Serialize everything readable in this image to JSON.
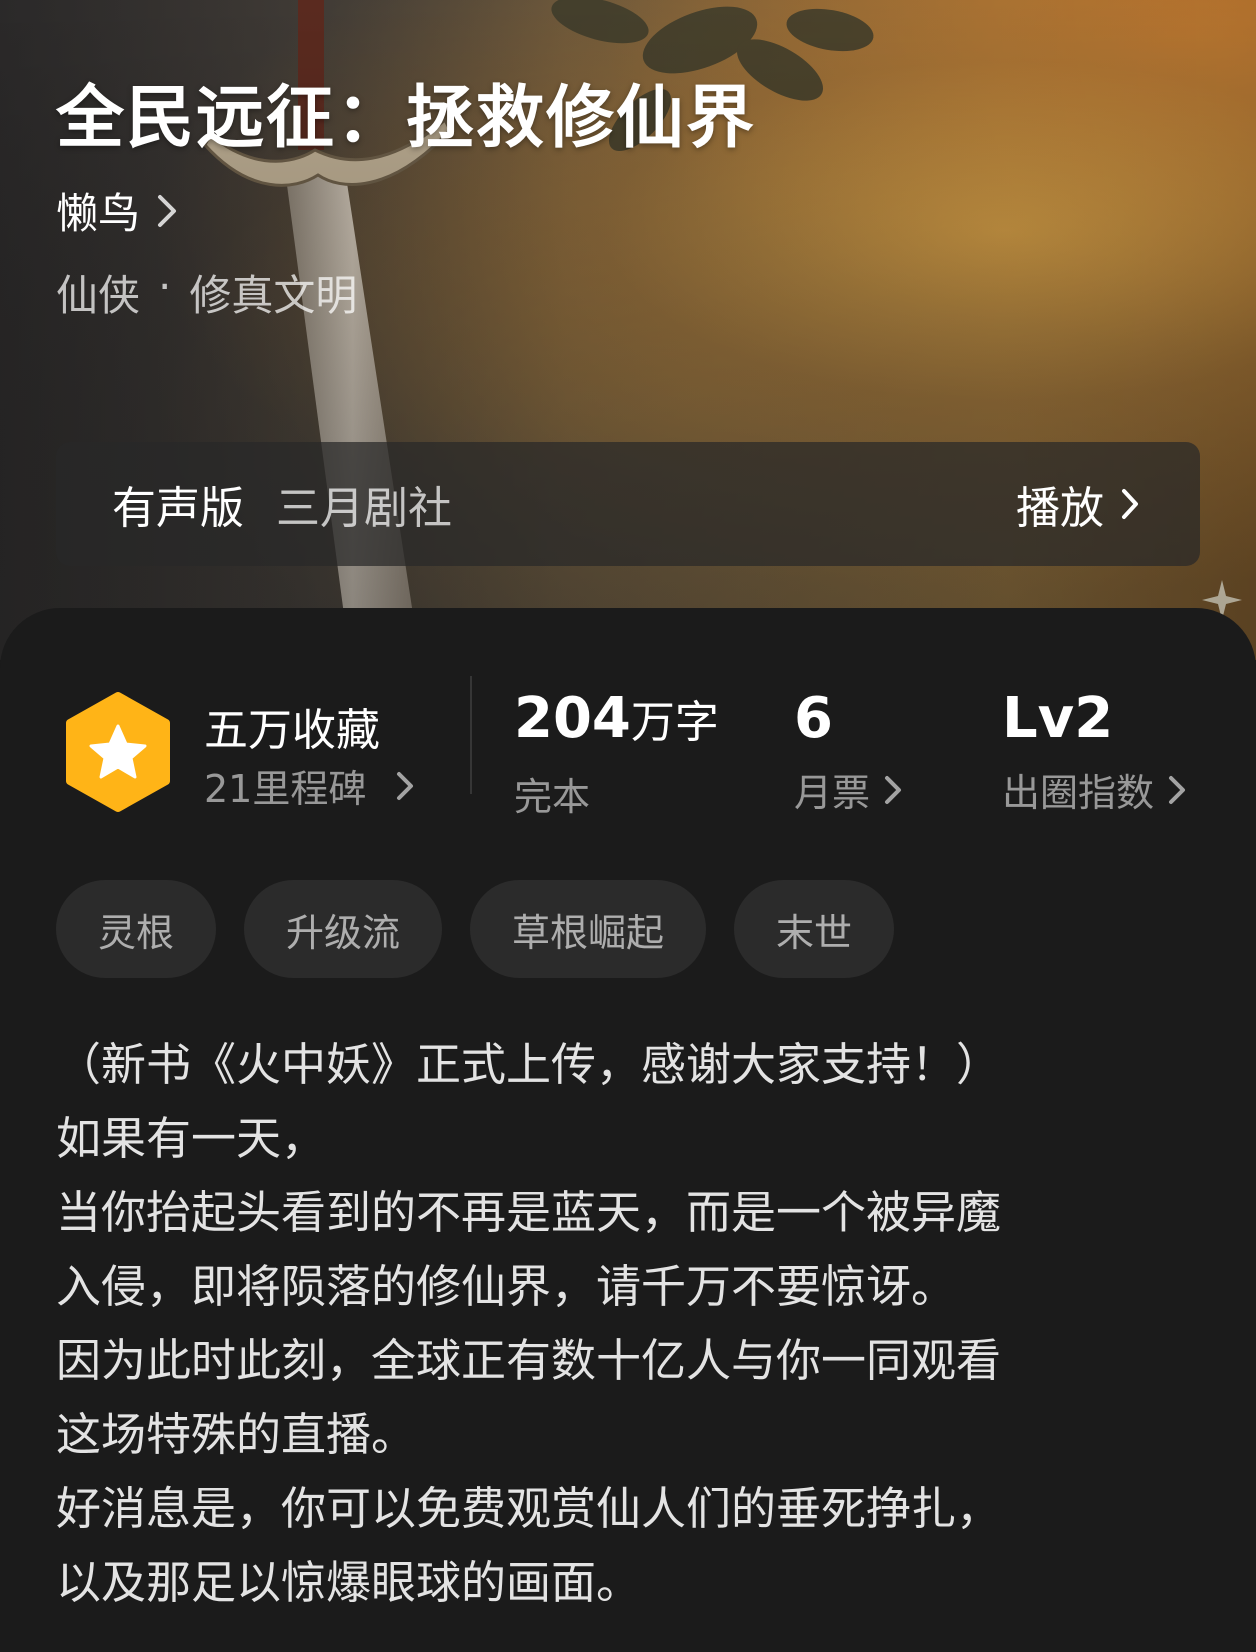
{
  "book": {
    "title": "全民远征：拯救修仙界",
    "author": "懒鸟",
    "genre": "仙侠",
    "genre_separator": "·",
    "subgenre": "修真文明"
  },
  "audio": {
    "label": "有声版",
    "studio": "三月剧社",
    "play_label": "播放"
  },
  "milestone": {
    "title": "五万收藏",
    "subtitle": "21里程碑",
    "badge_color": "#FFB417"
  },
  "stats": {
    "word_count": "204",
    "word_unit": "万字",
    "status": "完本",
    "monthly_tickets": "6",
    "monthly_tickets_label": "月票",
    "level": "Lv2",
    "level_label": "出圈指数"
  },
  "tags": [
    "灵根",
    "升级流",
    "草根崛起",
    "末世"
  ],
  "description": [
    "（新书《火中妖》正式上传，感谢大家支持！）",
    "如果有一天，",
    "当你抬起头看到的不再是蓝天，而是一个被异魔",
    "入侵，即将陨落的修仙界，请千万不要惊讶。",
    "因为此时此刻，全球正有数十亿人与你一同观看",
    "这场特殊的直播。",
    "好消息是，你可以免费观赏仙人们的垂死挣扎，",
    "以及那足以惊爆眼球的画面。"
  ]
}
